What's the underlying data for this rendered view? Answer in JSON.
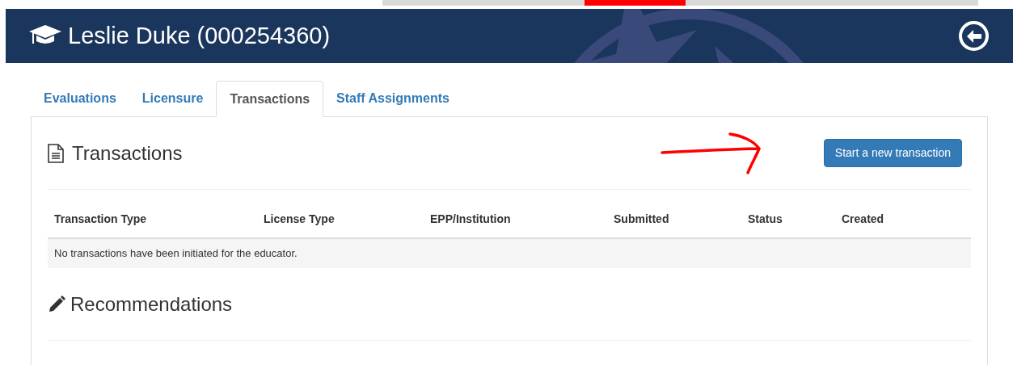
{
  "header": {
    "title": "Leslie Duke (000254360)"
  },
  "tabs": [
    {
      "label": "Evaluations",
      "selected": false
    },
    {
      "label": "Licensure",
      "selected": false
    },
    {
      "label": "Transactions",
      "selected": true
    },
    {
      "label": "Staff Assignments",
      "selected": false
    }
  ],
  "transactions": {
    "heading": "Transactions",
    "button": "Start a new transaction",
    "columns": [
      "Transaction Type",
      "License Type",
      "EPP/Institution",
      "Submitted",
      "Status",
      "Created"
    ],
    "empty_message": "No transactions have been initiated for the educator."
  },
  "recommendations": {
    "heading": "Recommendations"
  }
}
